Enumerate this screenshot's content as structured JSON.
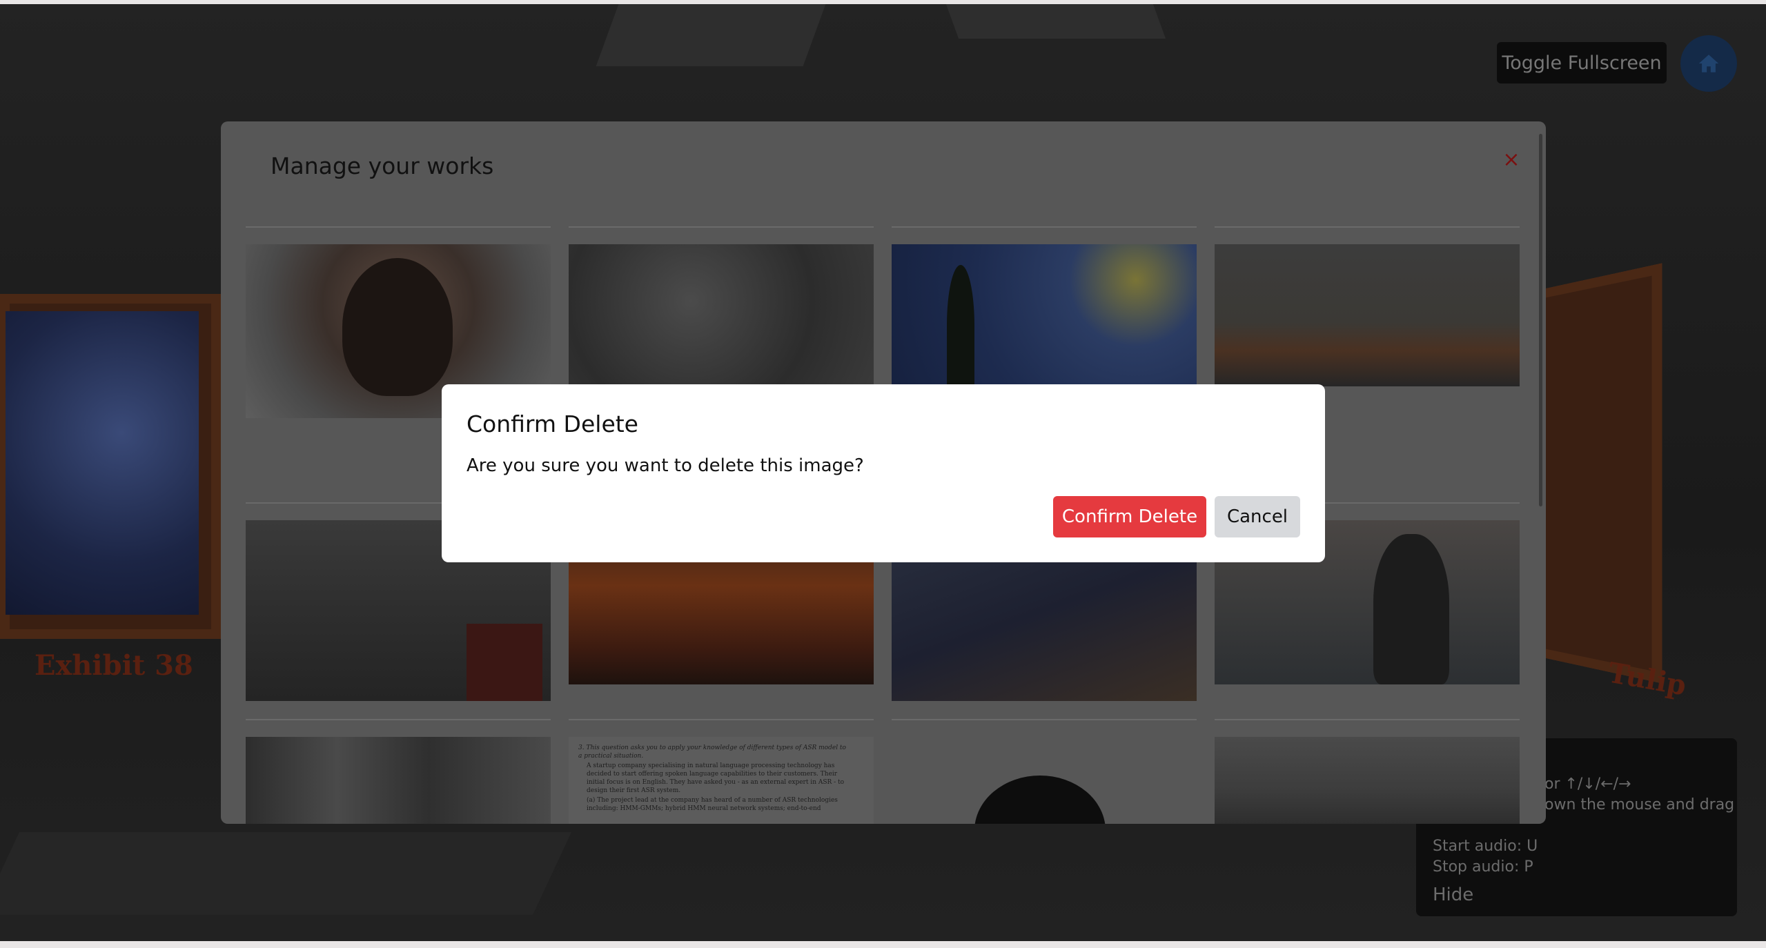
{
  "topbar": {
    "toggle_fullscreen_label": "Toggle Fullscreen"
  },
  "gallery": {
    "exhibit_left_label": "Exhibit 38",
    "exhibit_right_label": "Tulip"
  },
  "help_panel": {
    "lines": [
      "or ↑/↓/←/→",
      "own the mouse and drag",
      "Start audio: U",
      "Stop audio: P"
    ],
    "hide_label": "Hide"
  },
  "manage_modal": {
    "title": "Manage your works",
    "close_glyph": "×"
  },
  "paper_excerpt": {
    "line1": "3. This question asks you to apply your knowledge of different types of ASR model to a practical situation.",
    "line2": "A startup company specialising in natural language processing technology has decided to start offering spoken language capabilities to their customers. Their initial focus is on English. They have asked you - as an external expert in ASR - to design their first ASR system.",
    "line3": "(a) The project lead at the company has heard of a number of ASR technologies including: HMM-GMMs; hybrid HMM neural network systems; end-to-end"
  },
  "confirm_dialog": {
    "title": "Confirm Delete",
    "message": "Are you sure you want to delete this image?",
    "confirm_label": "Confirm Delete",
    "cancel_label": "Cancel"
  },
  "colors": {
    "confirm_button": "#e53a3f",
    "cancel_button": "#d7d9dc",
    "close_icon": "#7a1010"
  },
  "icons": {
    "home": "home-icon",
    "close": "close-icon"
  }
}
